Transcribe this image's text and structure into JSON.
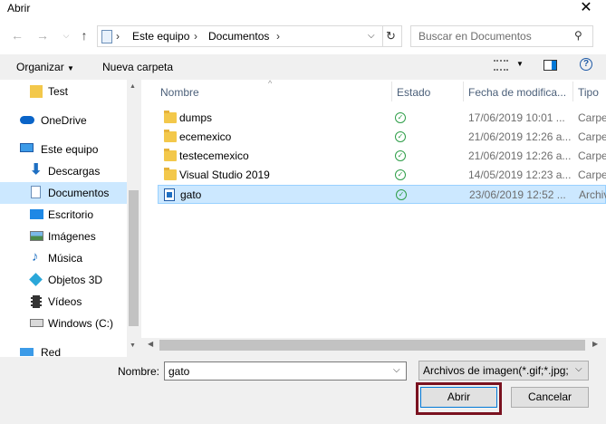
{
  "window": {
    "title": "Abrir"
  },
  "nav": {
    "breadcrumb": [
      "Este equipo",
      "Documentos"
    ],
    "search_placeholder": "Buscar en Documentos"
  },
  "toolbar": {
    "organize": "Organizar",
    "new_folder": "Nueva carpeta"
  },
  "sidebar": {
    "items": [
      {
        "label": "Test"
      },
      {
        "label": "OneDrive"
      },
      {
        "label": "Este equipo"
      },
      {
        "label": "Descargas"
      },
      {
        "label": "Documentos"
      },
      {
        "label": "Escritorio"
      },
      {
        "label": "Imágenes"
      },
      {
        "label": "Música"
      },
      {
        "label": "Objetos 3D"
      },
      {
        "label": "Vídeos"
      },
      {
        "label": "Windows (C:)"
      },
      {
        "label": "Red"
      }
    ]
  },
  "columns": {
    "name": "Nombre",
    "status": "Estado",
    "date": "Fecha de modifica...",
    "type": "Tipo"
  },
  "files": [
    {
      "name": "dumps",
      "date": "17/06/2019 10:01 ...",
      "type": "Carpe"
    },
    {
      "name": "ecemexico",
      "date": "21/06/2019 12:26 a...",
      "type": "Carpe"
    },
    {
      "name": "testecemexico",
      "date": "21/06/2019 12:26 a...",
      "type": "Carpe"
    },
    {
      "name": "Visual Studio 2019",
      "date": "14/05/2019 12:23 a...",
      "type": "Carpe"
    },
    {
      "name": "gato",
      "date": "23/06/2019 12:52 ...",
      "type": "Archiv"
    }
  ],
  "footer": {
    "name_label": "Nombre:",
    "name_value": "gato",
    "filter_value": "Archivos de imagen(*.gif;*.jpg;",
    "open": "Abrir",
    "cancel": "Cancelar"
  },
  "colors": {
    "selection": "#cce8ff",
    "accent": "#0078d7",
    "focus_frame": "#7a1220"
  }
}
